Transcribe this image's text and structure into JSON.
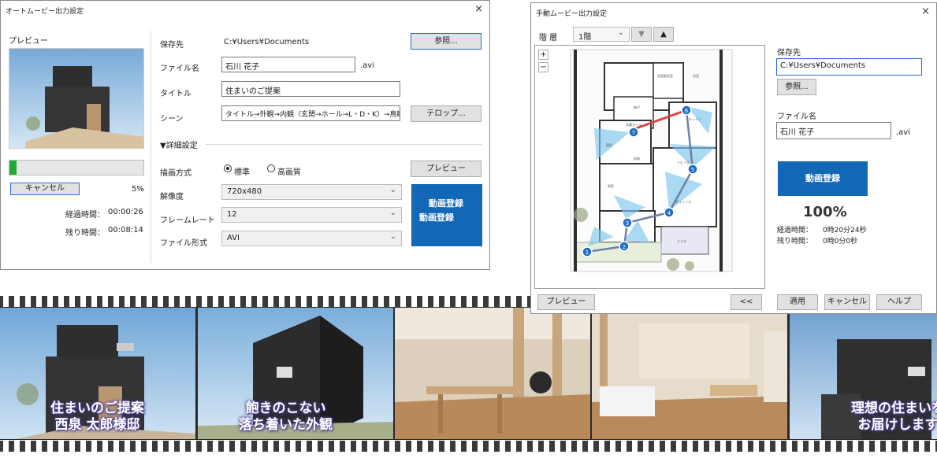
{
  "auto_dialog": {
    "title": "オートムービー出力設定",
    "close": "×",
    "preview_label": "プレビュー",
    "progress_fraction": 0.05,
    "cancel_label": "キャンセル",
    "percent": "5%",
    "elapsed_label": "経過時間：",
    "elapsed_value": "00:00:26",
    "remaining_label": "残り時間：",
    "remaining_value": "00:08:14",
    "save_label": "保存先",
    "save_value": "C:¥Users¥Documents",
    "browse_label": "参照...",
    "filename_label": "ファイル名",
    "filename_value": "石川 花子",
    "ext": ".avi",
    "title_label": "タイトル",
    "title_value": "住まいのご提案",
    "scene_label": "シーン",
    "scene_value": "タイトル→外観→内観（玄関→ホール→L・D・K）→鳥瞰→ｴ",
    "telop_label": "テロップ...",
    "details_label": "▼詳細設定",
    "render_label": "描画方式",
    "render_standard": "標準",
    "render_high": "高画質",
    "preview_button": "プレビュー",
    "resolution_label": "解像度",
    "resolution_value": "720x480",
    "framerate_label": "フレームレート",
    "framerate_value": "12",
    "format_label": "ファイル形式",
    "format_value": "AVI",
    "register_line1": "動画登録",
    "register_line2": "動画登録"
  },
  "manual_dialog": {
    "title": "手動ムービー出力設定",
    "close": "×",
    "floor_label": "階 層",
    "floor_value": "1階",
    "zoom_in": "+",
    "zoom_out": "−",
    "waypoints": [
      "1",
      "2",
      "3",
      "4",
      "5",
      "6",
      "7"
    ],
    "save_label": "保存先",
    "save_value": "C:¥Users¥Documents",
    "browse_label": "参照...",
    "filename_label": "ファイル名",
    "filename_value": "石川 花子",
    "ext": ".avi",
    "register_label": "動画登録",
    "percent": "100%",
    "elapsed_label": "経過時間：",
    "elapsed_value": "0時20分24秒",
    "remaining_label": "残り時間：",
    "remaining_value": "0時0分0秒",
    "preview_button": "プレビュー",
    "back_button": "<<",
    "apply_button": "適用",
    "cancel_button": "キャンセル",
    "help_button": "ヘルプ",
    "plan_tags": [
      "洗面脱衣室",
      "浴室",
      "納戸",
      "玄関ホール",
      "寝室",
      "収納",
      "和室",
      "リビング",
      "ダイニング",
      "キッチン",
      "テラス"
    ]
  },
  "filmstrip": {
    "captions": [
      [
        "住まいのご提案",
        "西泉 太郎様邸"
      ],
      [
        "飽きのこない",
        "落ち着いた外観"
      ],
      [
        "理想の住まいを",
        "お届けします"
      ]
    ]
  },
  "colors": {
    "accent": "#1367b7",
    "progress": "#22aa33",
    "route": "#dd4444",
    "view_cone": "#7cc6ee"
  }
}
